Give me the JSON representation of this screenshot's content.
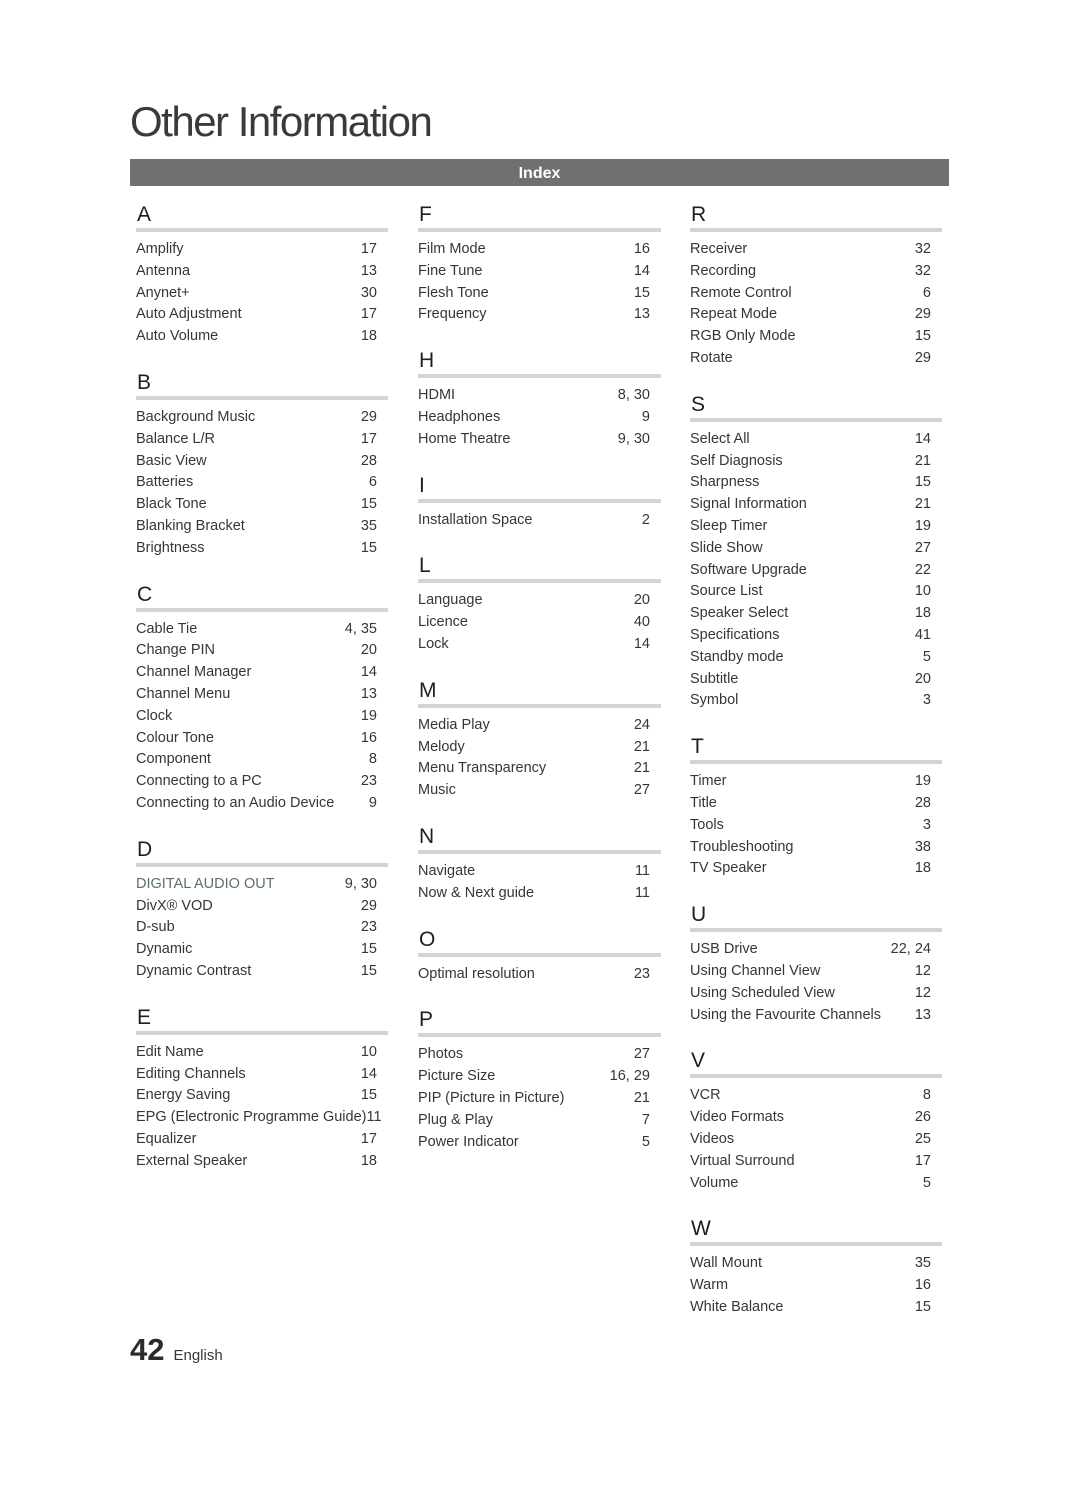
{
  "page": {
    "title": "Other Information",
    "index_label": "Index",
    "page_number": "42",
    "language": "English"
  },
  "columns": [
    {
      "sections": [
        {
          "letter": "A",
          "items": [
            {
              "term": "Amplify",
              "pages": "17"
            },
            {
              "term": "Antenna",
              "pages": "13"
            },
            {
              "term": "Anynet+",
              "pages": "30"
            },
            {
              "term": "Auto Adjustment",
              "pages": "17"
            },
            {
              "term": "Auto Volume",
              "pages": "18"
            }
          ]
        },
        {
          "letter": "B",
          "items": [
            {
              "term": "Background Music",
              "pages": "29"
            },
            {
              "term": "Balance  L/R",
              "pages": "17"
            },
            {
              "term": "Basic View",
              "pages": "28"
            },
            {
              "term": "Batteries",
              "pages": "6"
            },
            {
              "term": "Black Tone",
              "pages": "15"
            },
            {
              "term": "Blanking Bracket",
              "pages": "35"
            },
            {
              "term": "Brightness",
              "pages": "15"
            }
          ]
        },
        {
          "letter": "C",
          "items": [
            {
              "term": "Cable Tie",
              "pages": "4, 35"
            },
            {
              "term": "Change PIN",
              "pages": "20"
            },
            {
              "term": "Channel Manager",
              "pages": "14"
            },
            {
              "term": "Channel Menu",
              "pages": "13"
            },
            {
              "term": "Clock",
              "pages": "19"
            },
            {
              "term": "Colour Tone",
              "pages": "16"
            },
            {
              "term": "Component",
              "pages": "8"
            },
            {
              "term": "Connecting to a PC",
              "pages": "23"
            },
            {
              "term": "Connecting to an Audio Device",
              "pages": "9"
            }
          ]
        },
        {
          "letter": "D",
          "items": [
            {
              "term": "DIGITAL AUDIO OUT",
              "pages": "9, 30",
              "highlight": true
            },
            {
              "term": "DivX® VOD",
              "pages": "29"
            },
            {
              "term": "D-sub",
              "pages": "23"
            },
            {
              "term": "Dynamic",
              "pages": "15"
            },
            {
              "term": "Dynamic Contrast",
              "pages": "15"
            }
          ]
        },
        {
          "letter": "E",
          "items": [
            {
              "term": "Edit Name",
              "pages": "10"
            },
            {
              "term": "Editing Channels",
              "pages": "14"
            },
            {
              "term": "Energy Saving",
              "pages": "15"
            },
            {
              "term": "EPG (Electronic Programme Guide)",
              "pages": "11"
            },
            {
              "term": "Equalizer",
              "pages": "17"
            },
            {
              "term": "External Speaker",
              "pages": "18"
            }
          ]
        }
      ]
    },
    {
      "sections": [
        {
          "letter": "F",
          "items": [
            {
              "term": "Film Mode",
              "pages": "16"
            },
            {
              "term": "Fine Tune",
              "pages": "14"
            },
            {
              "term": "Flesh Tone",
              "pages": "15"
            },
            {
              "term": "Frequency",
              "pages": "13"
            }
          ]
        },
        {
          "letter": "H",
          "items": [
            {
              "term": "HDMI",
              "pages": "8, 30"
            },
            {
              "term": "Headphones",
              "pages": "9"
            },
            {
              "term": "Home Theatre",
              "pages": "9, 30"
            }
          ]
        },
        {
          "letter": "I",
          "items": [
            {
              "term": "Installation Space",
              "pages": "2"
            }
          ]
        },
        {
          "letter": "L",
          "items": [
            {
              "term": "Language",
              "pages": "20"
            },
            {
              "term": "Licence",
              "pages": "40"
            },
            {
              "term": "Lock",
              "pages": "14"
            }
          ]
        },
        {
          "letter": "M",
          "items": [
            {
              "term": "Media Play",
              "pages": "24"
            },
            {
              "term": "Melody",
              "pages": "21"
            },
            {
              "term": "Menu Transparency",
              "pages": "21"
            },
            {
              "term": "Music",
              "pages": "27"
            }
          ]
        },
        {
          "letter": "N",
          "items": [
            {
              "term": "Navigate",
              "pages": "11"
            },
            {
              "term": "Now & Next guide",
              "pages": "11"
            }
          ]
        },
        {
          "letter": "O",
          "items": [
            {
              "term": "Optimal resolution",
              "pages": "23"
            }
          ]
        },
        {
          "letter": "P",
          "items": [
            {
              "term": "Photos",
              "pages": "27"
            },
            {
              "term": "Picture Size",
              "pages": "16, 29"
            },
            {
              "term": "PIP (Picture in Picture)",
              "pages": "21"
            },
            {
              "term": "Plug & Play",
              "pages": "7"
            },
            {
              "term": "Power Indicator",
              "pages": "5"
            }
          ]
        }
      ]
    },
    {
      "sections": [
        {
          "letter": "R",
          "items": [
            {
              "term": "Receiver",
              "pages": "32"
            },
            {
              "term": "Recording",
              "pages": "32"
            },
            {
              "term": "Remote Control",
              "pages": "6"
            },
            {
              "term": "Repeat Mode",
              "pages": "29"
            },
            {
              "term": "RGB Only Mode",
              "pages": "15"
            },
            {
              "term": "Rotate",
              "pages": "29"
            }
          ]
        },
        {
          "letter": "S",
          "items": [
            {
              "term": "Select All",
              "pages": "14"
            },
            {
              "term": "Self Diagnosis",
              "pages": "21"
            },
            {
              "term": "Sharpness",
              "pages": "15"
            },
            {
              "term": "Signal Information",
              "pages": "21"
            },
            {
              "term": "Sleep Timer",
              "pages": "19"
            },
            {
              "term": "Slide Show",
              "pages": "27"
            },
            {
              "term": "Software Upgrade",
              "pages": "22"
            },
            {
              "term": "Source List",
              "pages": "10"
            },
            {
              "term": "Speaker Select",
              "pages": "18"
            },
            {
              "term": "Specifications",
              "pages": "41"
            },
            {
              "term": "Standby mode",
              "pages": "5"
            },
            {
              "term": "Subtitle",
              "pages": "20"
            },
            {
              "term": "Symbol",
              "pages": "3"
            }
          ]
        },
        {
          "letter": "T",
          "items": [
            {
              "term": "Timer",
              "pages": "19"
            },
            {
              "term": "Title",
              "pages": "28"
            },
            {
              "term": "Tools",
              "pages": "3"
            },
            {
              "term": "Troubleshooting",
              "pages": "38"
            },
            {
              "term": "TV Speaker",
              "pages": "18"
            }
          ]
        },
        {
          "letter": "U",
          "items": [
            {
              "term": "USB Drive",
              "pages": "22, 24"
            },
            {
              "term": "Using Channel View",
              "pages": "12"
            },
            {
              "term": "Using Scheduled View",
              "pages": "12"
            },
            {
              "term": "Using the Favourite Channels",
              "pages": "13"
            }
          ]
        },
        {
          "letter": "V",
          "items": [
            {
              "term": "VCR",
              "pages": "8"
            },
            {
              "term": "Video Formats",
              "pages": "26"
            },
            {
              "term": "Videos",
              "pages": "25"
            },
            {
              "term": "Virtual Surround",
              "pages": "17"
            },
            {
              "term": "Volume",
              "pages": "5"
            }
          ]
        },
        {
          "letter": "W",
          "items": [
            {
              "term": "Wall Mount",
              "pages": "35"
            },
            {
              "term": "Warm",
              "pages": "16"
            },
            {
              "term": "White Balance",
              "pages": "15"
            }
          ]
        }
      ]
    }
  ]
}
